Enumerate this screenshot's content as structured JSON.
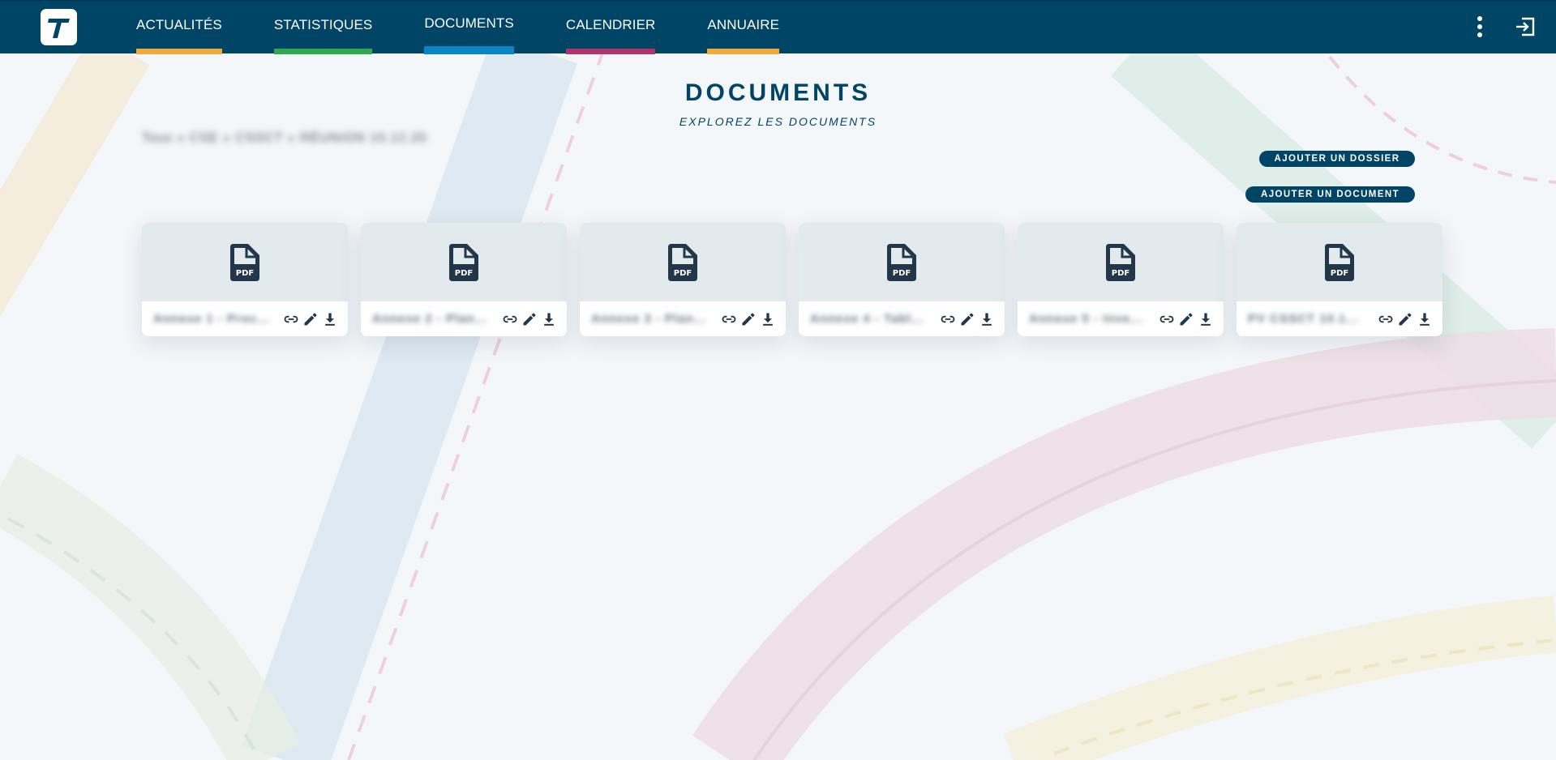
{
  "app": {
    "logo_letter": "T",
    "colors": {
      "header_bg": "#004466",
      "accent_yellow": "#f2a93b",
      "accent_green": "#2fa84f",
      "accent_blue": "#0a86c7",
      "accent_magenta": "#b0336a",
      "text_dark": "#004466",
      "card_icon": "#22374a"
    }
  },
  "nav": {
    "items": [
      {
        "label": "ACTUALITÉS",
        "color": "#f2a93b",
        "active": false
      },
      {
        "label": "STATISTIQUES",
        "color": "#2fa84f",
        "active": false
      },
      {
        "label": "DOCUMENTS",
        "color": "#0a86c7",
        "active": true
      },
      {
        "label": "CALENDRIER",
        "color": "#b0336a",
        "active": false
      },
      {
        "label": "ANNUAIRE",
        "color": "#f2a93b",
        "active": false
      }
    ],
    "right_icons": [
      "more-vertical-icon",
      "logout-icon"
    ]
  },
  "main": {
    "title": "DOCUMENTS",
    "subtitle": "EXPLOREZ LES DOCUMENTS",
    "breadcrumb": "Tous » CSE » CSSCT » RÉUNION 10.12.20",
    "add_folder_label": "AJOUTER UN DOSSIER",
    "add_document_label": "AJOUTER UN DOCUMENT"
  },
  "documents": [
    {
      "name": "Annexe 1 - Proc...",
      "type": "PDF"
    },
    {
      "name": "Annexe 2 - Plan...",
      "type": "PDF"
    },
    {
      "name": "Annexe 3 - Plan...",
      "type": "PDF"
    },
    {
      "name": "Annexe 4 - Tabl...",
      "type": "PDF"
    },
    {
      "name": "Annexe 5 - Inve...",
      "type": "PDF"
    },
    {
      "name": "PV CSSCT 10.1...",
      "type": "PDF"
    }
  ],
  "card_action_icons": [
    "link-icon",
    "edit-pencil-icon",
    "download-icon"
  ]
}
